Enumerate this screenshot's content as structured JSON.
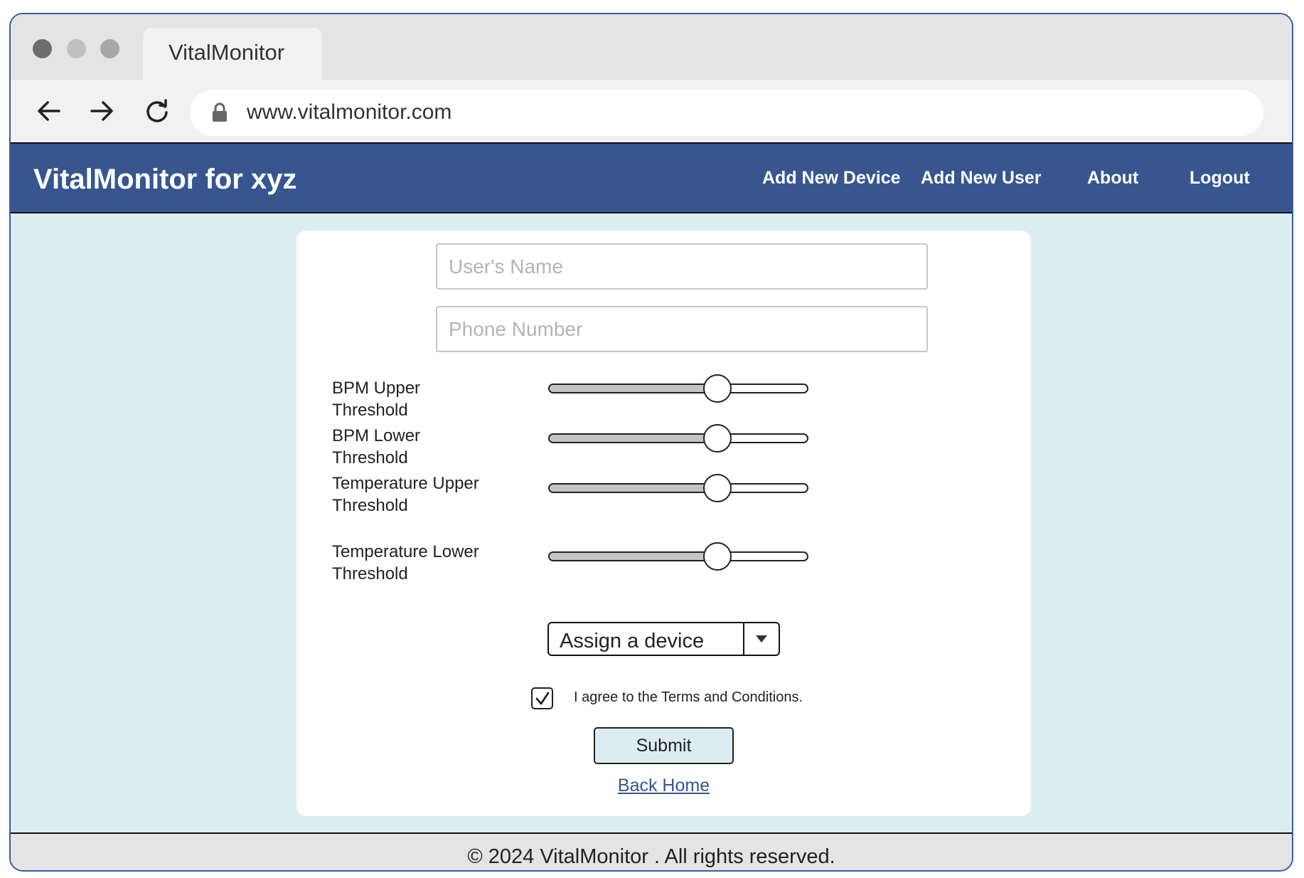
{
  "browser": {
    "tab_title": "VitalMonitor",
    "url": "www.vitalmonitor.com"
  },
  "header": {
    "brand": "VitalMonitor for xyz",
    "nav": [
      "Add New Device",
      "Add New User",
      "About",
      "Logout"
    ]
  },
  "form": {
    "name_placeholder": "User's Name",
    "phone_placeholder": "Phone Number",
    "sliders": [
      {
        "label": "BPM Upper Threshold",
        "value": 0.65
      },
      {
        "label": "BPM Lower Threshold",
        "value": 0.65
      },
      {
        "label": "Temperature Upper Threshold",
        "value": 0.65
      },
      {
        "label": "Temperature Lower Threshold",
        "value": 0.65
      }
    ],
    "device_select": "Assign a device",
    "terms": "I agree to the Terms and Conditions.",
    "terms_checked": true,
    "submit": "Submit",
    "back_home": "Back Home"
  },
  "footer": {
    "text": "© 2024 VitalMonitor . All rights reserved."
  },
  "colors": {
    "header_bg": "#37568f",
    "content_bg": "#dbedf3",
    "link": "#37568f"
  }
}
